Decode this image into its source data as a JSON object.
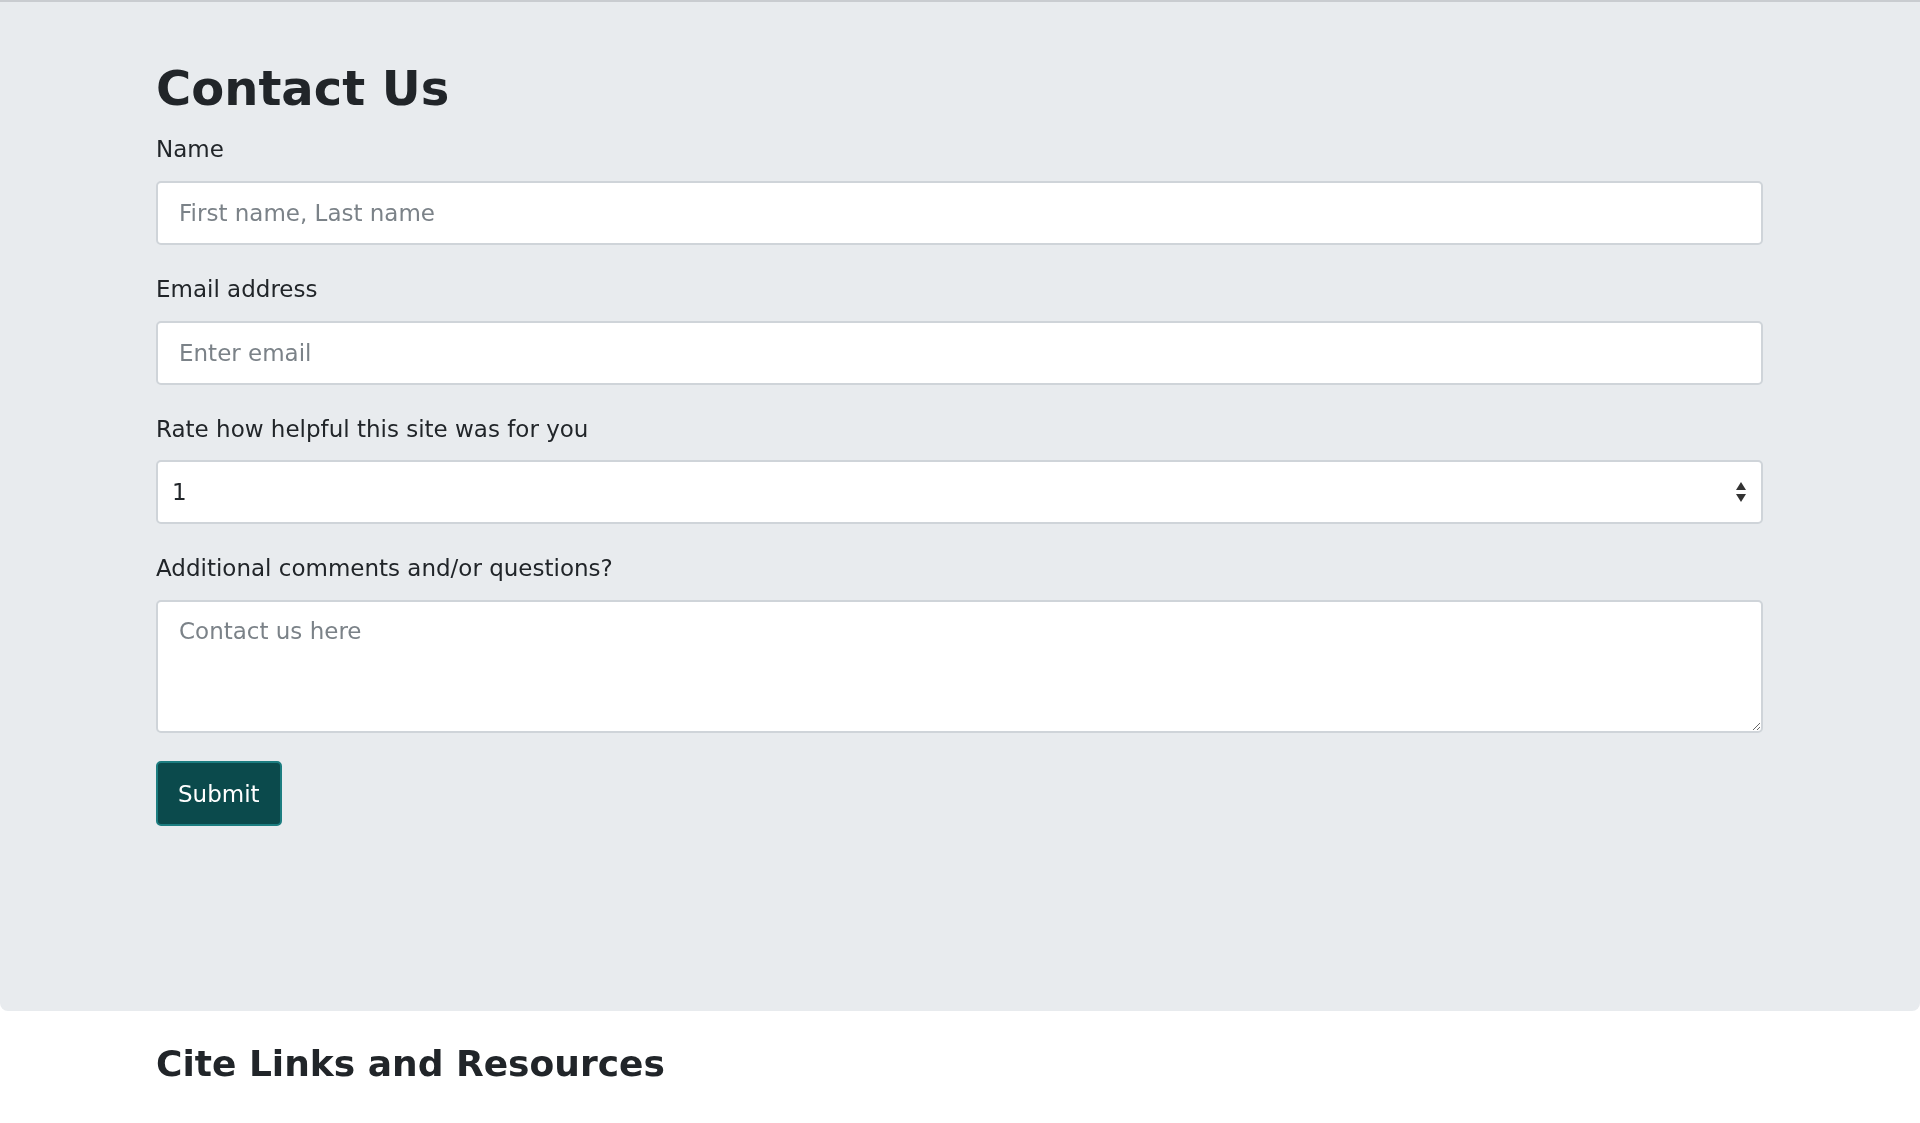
{
  "title": "Contact Us",
  "fields": [
    {
      "kind": "input",
      "label": "Name",
      "placeholder": "First name, Last name"
    },
    {
      "kind": "input",
      "label": "Email address",
      "placeholder": "Enter email"
    },
    {
      "kind": "select",
      "label": "Rate how helpful this site was for you",
      "value": "1"
    },
    {
      "kind": "textarea",
      "label": "Additional comments and/or questions?",
      "placeholder": "Contact us here"
    }
  ],
  "submit": "Submit",
  "next_section": {
    "title": "Cite Links and Resources"
  }
}
